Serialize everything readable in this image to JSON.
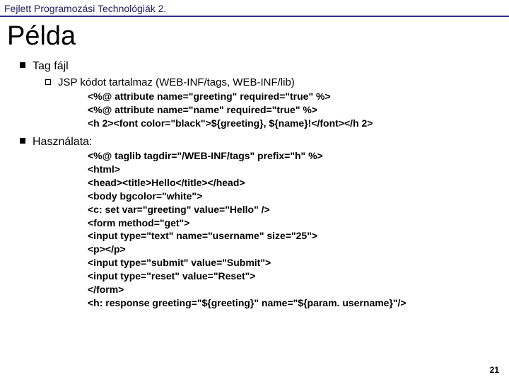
{
  "header": "Fejlett Programozási Technológiák 2.",
  "title": "Példa",
  "bullet1": "Tag fájl",
  "sub1": "JSP kódot tartalmaz (WEB-INF/tags, WEB-INF/lib)",
  "code1": "<%@ attribute name=\"greeting\" required=\"true\" %>\n<%@ attribute name=\"name\" required=\"true\" %>\n<h 2><font color=\"black\">${greeting}, ${name}!</font></h 2>",
  "bullet2": "Használata:",
  "code2": "<%@ taglib tagdir=\"/WEB-INF/tags\" prefix=\"h\" %>\n<html>\n<head><title>Hello</title></head>\n<body bgcolor=\"white\">\n<c: set var=\"greeting\" value=\"Hello\" />\n<form method=\"get\">\n<input type=\"text\" name=\"username\" size=\"25\">\n<p></p>\n<input type=\"submit\" value=\"Submit\">\n<input type=\"reset\" value=\"Reset\">\n</form>\n<h: response greeting=\"${greeting}\" name=\"${param. username}\"/>",
  "pageNumber": "21"
}
